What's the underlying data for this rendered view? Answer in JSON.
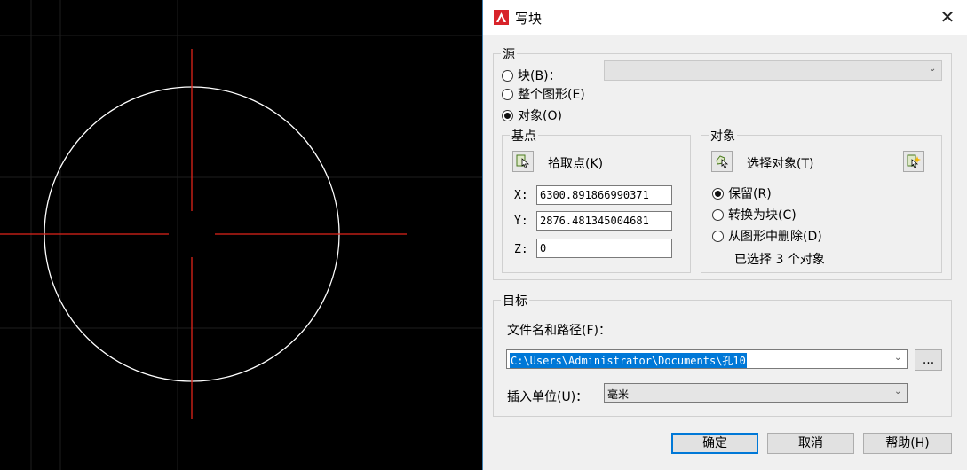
{
  "dialog": {
    "title": "写块",
    "source": {
      "label": "源",
      "block_radio": "块(B)：",
      "whole_drawing_radio": "整个图形(E)",
      "objects_radio": "对象(O)",
      "selected": "objects"
    },
    "base_point": {
      "label": "基点",
      "pick_point": "拾取点(K)",
      "x_label": "X:",
      "y_label": "Y:",
      "z_label": "Z:",
      "x_value": "6300.891866990371",
      "y_value": "2876.481345004681",
      "z_value": "0"
    },
    "objects": {
      "label": "对象",
      "select_objects": "选择对象(T)",
      "retain": "保留(R)",
      "convert_to_block": "转换为块(C)",
      "delete_from_drawing": "从图形中删除(D)",
      "selected_option": "retain",
      "selection_status": "已选择 3 个对象"
    },
    "destination": {
      "label": "目标",
      "file_path_label": "文件名和路径(F)：",
      "file_path_value": "C:\\Users\\Administrator\\Documents\\孔10",
      "browse_button": "...",
      "insert_units_label": "插入单位(U)：",
      "insert_units_value": "毫米"
    },
    "buttons": {
      "ok": "确定",
      "cancel": "取消",
      "help": "帮助(H)"
    }
  },
  "colors": {
    "canvas_bg": "#000000",
    "circle": "#ffffff",
    "crosshair": "#e0241a",
    "accent": "#0078d7",
    "logo_red": "#d8232a"
  },
  "icons": {
    "title": "autocad-logo-icon",
    "close": "close-icon",
    "pick_point": "pick-point-icon",
    "select_objects": "select-objects-icon",
    "quick_select": "quick-select-icon",
    "dropdown": "chevron-down-icon"
  }
}
